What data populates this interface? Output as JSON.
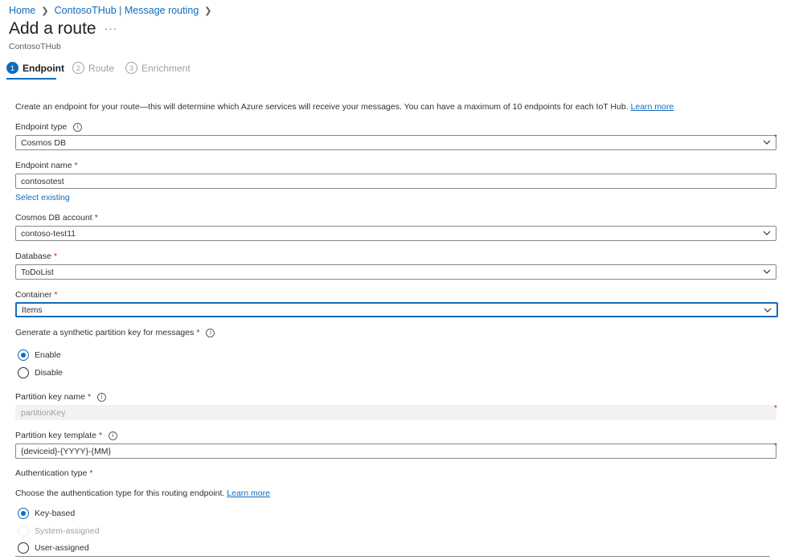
{
  "breadcrumb": {
    "home": "Home",
    "hub": "ContosoTHub | Message routing"
  },
  "header": {
    "title": "Add a route",
    "more": "···",
    "subtitle": "ContosoTHub"
  },
  "steps": [
    {
      "num": "1",
      "label": "Endpoint"
    },
    {
      "num": "2",
      "label": "Route"
    },
    {
      "num": "3",
      "label": "Enrichment"
    }
  ],
  "description": {
    "text": "Create an endpoint for your route—this will determine which Azure services will receive your messages. You can have a maximum of 10 endpoints for each IoT Hub.",
    "learn_more": "Learn more"
  },
  "form": {
    "endpoint_type": {
      "label": "Endpoint type",
      "value": "Cosmos DB"
    },
    "endpoint_name": {
      "label": "Endpoint name",
      "value": "contosotest",
      "select_existing": "Select existing"
    },
    "cosmos_account": {
      "label": "Cosmos DB account",
      "value": "contoso-test11"
    },
    "database": {
      "label": "Database",
      "value": "ToDoList"
    },
    "container": {
      "label": "Container",
      "value": "Items"
    },
    "synthetic_key": {
      "label": "Generate a synthetic partition key for messages",
      "options": [
        "Enable",
        "Disable"
      ]
    },
    "partition_key_name": {
      "label": "Partition key name",
      "value": "partitionKey"
    },
    "partition_key_template": {
      "label": "Partition key template",
      "value": "{deviceid}-{YYYY}-{MM}"
    },
    "auth": {
      "label": "Authentication type",
      "description": "Choose the authentication type for this routing endpoint.",
      "learn_more": "Learn more",
      "options": [
        "Key-based",
        "System-assigned",
        "User-assigned"
      ]
    }
  },
  "required_marker": "*",
  "colors": {
    "accent": "#0f6cbd",
    "required": "#a4262c",
    "disabled_bg": "#f3f2f1"
  }
}
